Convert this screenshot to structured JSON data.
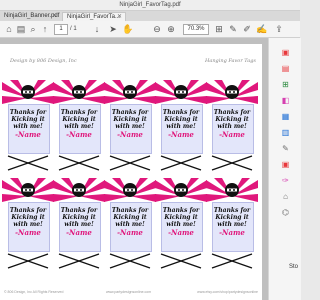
{
  "window": {
    "title": "NinjaGirl_FavorTag.pdf"
  },
  "tabs": [
    {
      "label": "NinjaGirl_Banner.pdf",
      "close": "✕"
    },
    {
      "label": "NinjaGirl_FavorTa...",
      "close": "✕"
    }
  ],
  "toolbar": {
    "page_current": "1",
    "page_total": "/ 1",
    "zoom": "70.3%",
    "icons": [
      "home-icon",
      "print-icon",
      "search-icon",
      "up-icon",
      "down-icon",
      "pan-icon",
      "minus-icon",
      "plus-icon",
      "download-icon",
      "comment-icon",
      "pen-icon",
      "sign-icon"
    ]
  },
  "document": {
    "header_left": "Design by 806 Design, Inc",
    "header_right": "Hanging Favor Tags",
    "footer_left": "© 806 Design, Inc All Rights Reserved",
    "footer_mid": "www.partydesignsonline.com",
    "footer_right": "www.etsy.com/shop/partydesignsonline",
    "tag": {
      "line1": "Thanks for",
      "line2": "Kicking it",
      "line3": "with me!",
      "line4": "-Name"
    }
  },
  "side_panel": {
    "bottom_label": "Sto",
    "icon_colors": [
      "#e8373b",
      "#e8373b",
      "#2b8a3e",
      "#d63fb0",
      "#1f6fd6",
      "#1f6fd6",
      "#6d6d6d",
      "#e8373b",
      "#d63fb0",
      "#6d6d6d",
      "#6d6d6d"
    ]
  },
  "colors": {
    "accent": "#e0187c",
    "card": "#e3e6fa"
  }
}
